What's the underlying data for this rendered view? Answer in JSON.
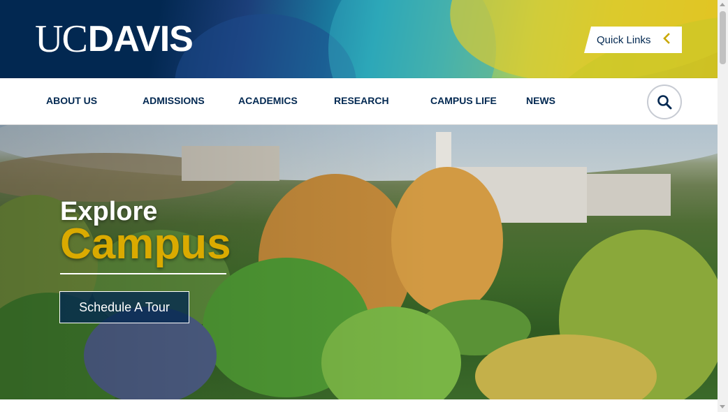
{
  "header": {
    "logo": {
      "uc": "UC",
      "davis": "DAVIS"
    },
    "quick_links": {
      "label": "Quick Links",
      "icon": "chevron-left-icon"
    }
  },
  "nav": {
    "items": [
      {
        "label": "ABOUT US"
      },
      {
        "label": "ADMISSIONS"
      },
      {
        "label": "ACADEMICS"
      },
      {
        "label": "RESEARCH"
      },
      {
        "label": "CAMPUS LIFE"
      },
      {
        "label": "NEWS"
      }
    ],
    "search_icon": "search-icon"
  },
  "hero": {
    "kicker": "Explore",
    "headline": "Campus",
    "cta_label": "Schedule A Tour"
  },
  "colors": {
    "navy": "#022851",
    "gold": "#daaa00",
    "quick_links_chevron": "#c9a800",
    "white": "#ffffff"
  }
}
